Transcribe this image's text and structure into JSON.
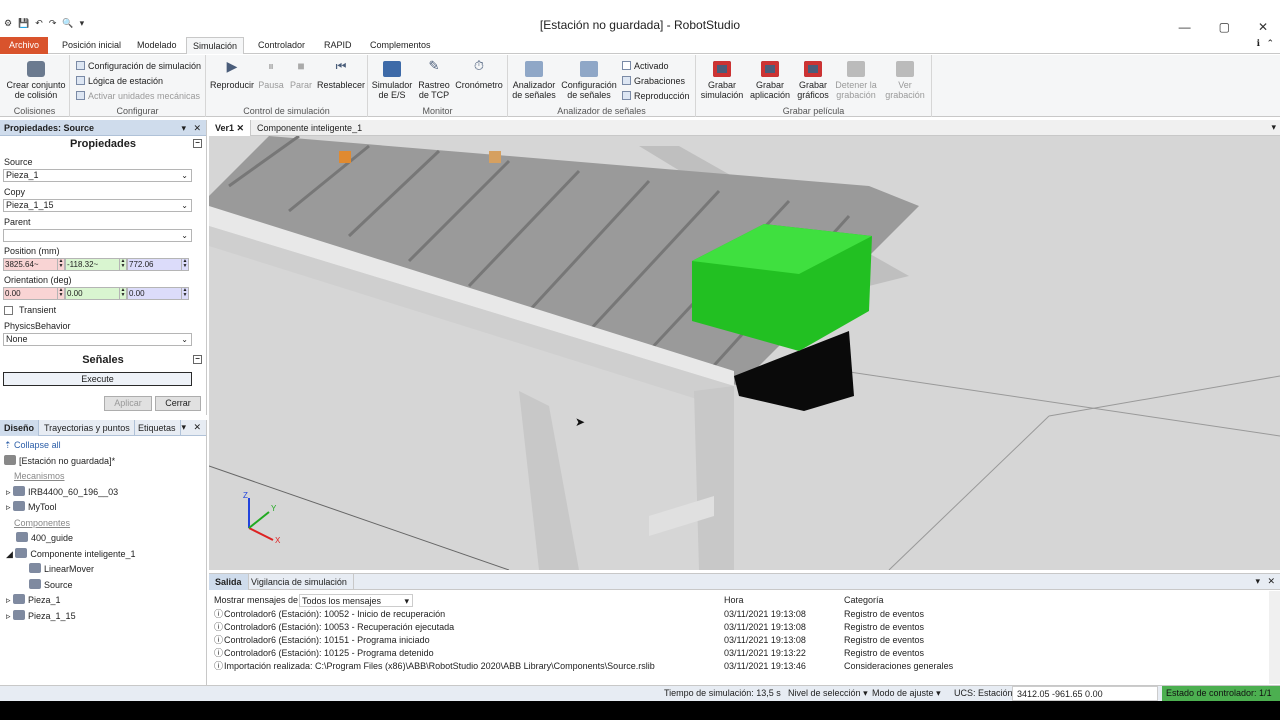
{
  "window": {
    "title": "[Estación no guardada] - RobotStudio",
    "minimize": "—",
    "maximize": "▢",
    "close": "✕"
  },
  "ribbon_tabs": [
    "Archivo",
    "Posición inicial",
    "Modelado",
    "Simulación",
    "Controlador",
    "RAPID",
    "Complementos"
  ],
  "active_tab": "Simulación",
  "ribbon": {
    "colisiones": {
      "crear": "Crear conjunto de colisión",
      "label": "Colisiones"
    },
    "configurar": {
      "config_sim": "Configuración de simulación",
      "logica": "Lógica de estación",
      "activar": "Activar unidades mecánicas",
      "label": "Configurar"
    },
    "control": {
      "reproducir": "Reproducir",
      "pausa": "Pausa",
      "parar": "Parar",
      "restablecer": "Restablecer",
      "label": "Control de simulación"
    },
    "monitor": {
      "simulador_es": "Simulador de E/S",
      "rastreo_tcp": "Rastreo de TCP",
      "cronometro": "Cronómetro",
      "label": "Monitor"
    },
    "analizador": {
      "analizador": "Analizador de señales",
      "config_senales": "Configuración de señales",
      "activado": "Activado",
      "grabaciones": "Grabaciones",
      "reproduccion": "Reproducción",
      "label": "Analizador de señales"
    },
    "grabar": {
      "grabar_sim": "Grabar simulación",
      "grabar_app": "Grabar aplicación",
      "grabar_graf": "Grabar gráficos",
      "detener": "Detener la grabación",
      "ver": "Ver grabación",
      "label": "Grabar película"
    }
  },
  "properties": {
    "header": "Propiedades: Source",
    "section": "Propiedades",
    "source_label": "Source",
    "source_value": "Pieza_1",
    "copy_label": "Copy",
    "copy_value": "Pieza_1_15",
    "parent_label": "Parent",
    "parent_value": "",
    "position_label": "Position (mm)",
    "position": [
      "3825.64~",
      "-118.32~",
      "772.06"
    ],
    "orientation_label": "Orientation (deg)",
    "orientation": [
      "0.00",
      "0.00",
      "0.00"
    ],
    "transient_label": "Transient",
    "physics_label": "PhysicsBehavior",
    "physics_value": "None",
    "signals_section": "Señales",
    "execute": "Execute",
    "apply": "Aplicar",
    "close": "Cerrar"
  },
  "design": {
    "tabs": [
      "Diseño",
      "Trayectorias y puntos",
      "Etiquetas"
    ],
    "collapse_all": "Collapse all",
    "station": "[Estación no guardada]*",
    "mechanisms_label": "Mecanismos",
    "mech1": "IRB4400_60_196__03",
    "mech2": "MyTool",
    "components_label": "Componentes",
    "comp1": "400_guide",
    "comp2": "Componente inteligente_1",
    "comp2a": "LinearMover",
    "comp2b": "Source",
    "comp3": "Pieza_1",
    "comp4": "Pieza_1_15"
  },
  "viewport_tabs": [
    "Ver1",
    "Componente inteligente_1"
  ],
  "axes": {
    "x": "X",
    "y": "Y",
    "z": "Z"
  },
  "output": {
    "tabs": [
      "Salida",
      "Vigilancia de simulación"
    ],
    "filter_label": "Mostrar mensajes de",
    "filter_value": "Todos los mensajes",
    "col_time": "Hora",
    "col_cat": "Categoría",
    "rows": [
      {
        "msg": "Controlador6 (Estación): 10052 - Inicio de recuperación",
        "time": "03/11/2021 19:13:08",
        "cat": "Registro de eventos"
      },
      {
        "msg": "Controlador6 (Estación): 10053 - Recuperación ejecutada",
        "time": "03/11/2021 19:13:08",
        "cat": "Registro de eventos"
      },
      {
        "msg": "Controlador6 (Estación): 10151 - Programa iniciado",
        "time": "03/11/2021 19:13:08",
        "cat": "Registro de eventos"
      },
      {
        "msg": "Controlador6 (Estación): 10125 - Programa detenido",
        "time": "03/11/2021 19:13:22",
        "cat": "Registro de eventos"
      },
      {
        "msg": "Importación realizada: C:\\Program Files (x86)\\ABB\\RobotStudio 2020\\ABB Library\\Components\\Source.rslib",
        "time": "03/11/2021 19:13:46",
        "cat": "Consideraciones generales"
      }
    ]
  },
  "status": {
    "sim_time": "Tiempo de simulación: 13,5 s",
    "sel_level": "Nivel de selección",
    "snap_mode": "Modo de ajuste",
    "ucs": "UCS: Estación",
    "coords": "3412.05 -961.65 0.00",
    "controller": "Estado de controlador: 1/1"
  }
}
